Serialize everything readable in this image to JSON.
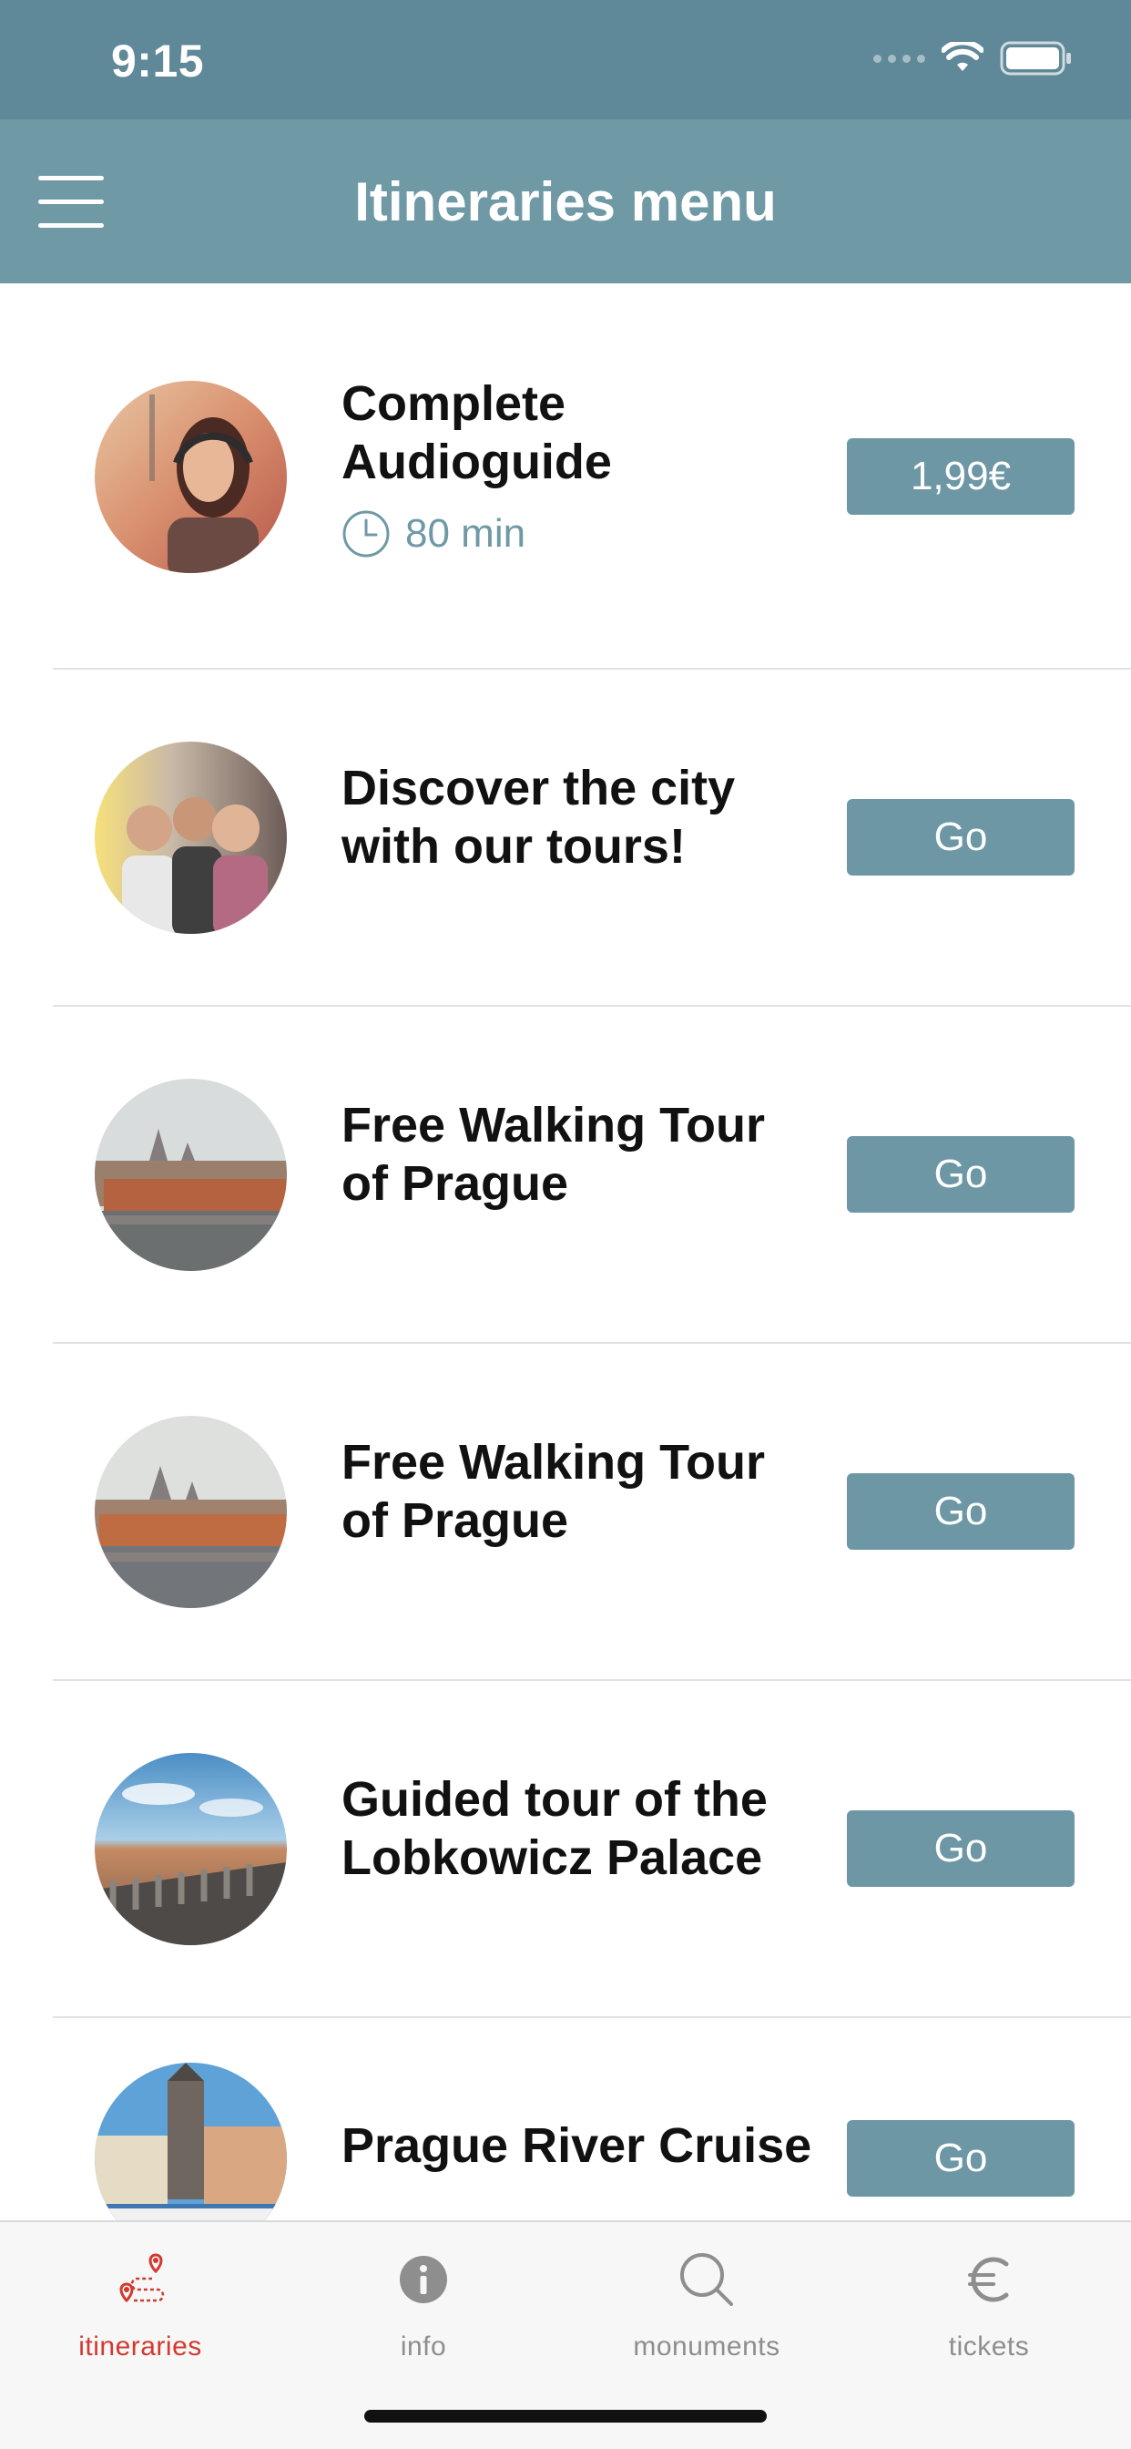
{
  "status_bar": {
    "time": "9:15"
  },
  "nav": {
    "title": "Itineraries menu"
  },
  "items": [
    {
      "title": "Complete Audioguide",
      "duration": "80 min",
      "button": "1,99€"
    },
    {
      "title": "Discover the city with our tours!",
      "button": "Go"
    },
    {
      "title": "Free Walking Tour of Prague",
      "button": "Go"
    },
    {
      "title": "Free Walking Tour of Prague",
      "button": "Go"
    },
    {
      "title": "Guided tour of the Lobkowicz Palace",
      "button": "Go"
    },
    {
      "title": "Prague River Cruise",
      "button": "Go"
    }
  ],
  "tabs": [
    {
      "label": "itineraries",
      "icon": "map-pin-route-icon",
      "active": true
    },
    {
      "label": "info",
      "icon": "info-icon",
      "active": false
    },
    {
      "label": "monuments",
      "icon": "search-icon",
      "active": false
    },
    {
      "label": "tickets",
      "icon": "euro-icon",
      "active": false
    }
  ],
  "colors": {
    "status_bar": "#5f8898",
    "nav_bar": "#7099a6",
    "button": "#6e97a5",
    "active_tab": "#d23a2f",
    "inactive_tab": "#8e8e8e"
  }
}
